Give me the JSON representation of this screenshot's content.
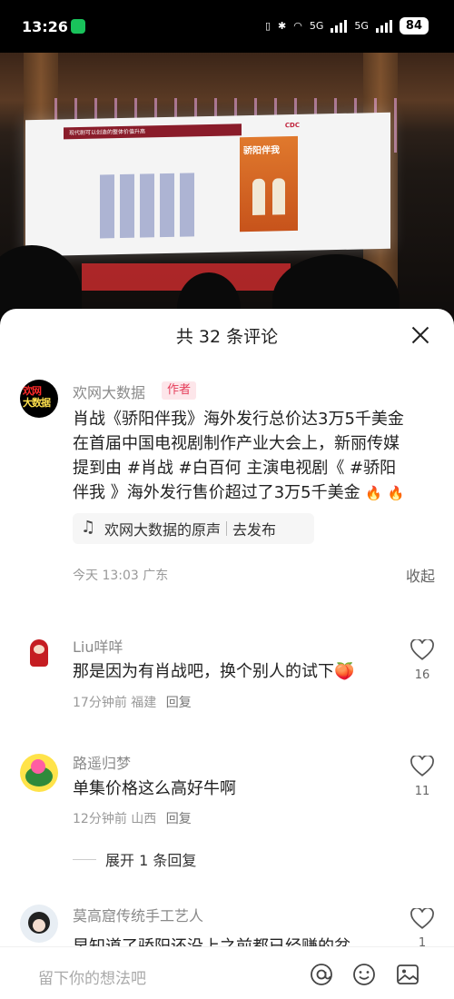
{
  "status_bar": {
    "time": "13:26",
    "network_1": "5G",
    "network_2": "5G",
    "battery": "84"
  },
  "sheet": {
    "title": "共 32 条评论"
  },
  "main_comment": {
    "author": "欢网大数据",
    "author_avatar_text_1": "欢网",
    "author_avatar_text_2": "大数据",
    "badge": "作者",
    "lines": [
      "肖战《骄阳伴我》海外发行总价达3万5千美金",
      "在首届中国电视剧制作产业大会上，新丽传媒",
      "提到由 #肖战 #白百何 主演电视剧《 #骄阳",
      "伴我 》海外发行售价超过了3万5千美金"
    ],
    "sound_label": "欢网大数据的原声",
    "sound_action": "去发布",
    "time": "今天 13:03",
    "location": "广东",
    "collapse": "收起"
  },
  "comments": [
    {
      "name": "Liu咩咩",
      "text": "那是因为有肖战吧，换个别人的试下🍑",
      "time": "17分钟前",
      "location": "福建",
      "reply": "回复",
      "likes": "16"
    },
    {
      "name": "路遥归梦",
      "text": "单集价格这么高好牛啊",
      "time": "12分钟前",
      "location": "山西",
      "reply": "回复",
      "likes": "11"
    },
    {
      "name": "莫高窟传统手工艺人",
      "text": "早知道了骄阳还没上之前都已经赚的盆",
      "likes": "1"
    }
  ],
  "expand_replies": "展开 1 条回复",
  "input": {
    "placeholder": "留下你的想法吧"
  },
  "screen": {
    "header": "现代剧可以创造的整体价值升高",
    "brand": "CDC",
    "poster_title": "骄阳伴我"
  }
}
